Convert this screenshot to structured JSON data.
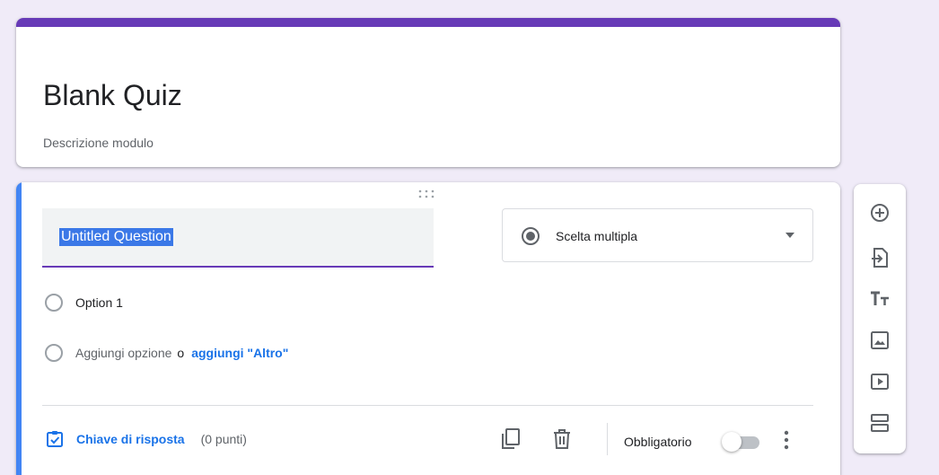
{
  "form": {
    "title": "Blank Quiz",
    "description": "Descrizione modulo"
  },
  "question": {
    "title": "Untitled Question",
    "type_label": "Scelta multipla",
    "options": [
      {
        "label": "Option 1"
      }
    ],
    "add_option_label": "Aggiungi opzione",
    "or_label": "o",
    "add_other_label": "aggiungi \"Altro\"",
    "answer_key_label": "Chiave di risposta",
    "points_label": "(0 punti)",
    "required_label": "Obbligatorio",
    "required_on": false
  },
  "toolbar": {
    "items": [
      {
        "icon": "add-question-icon"
      },
      {
        "icon": "import-questions-icon"
      },
      {
        "icon": "add-title-icon"
      },
      {
        "icon": "add-image-icon"
      },
      {
        "icon": "add-video-icon"
      },
      {
        "icon": "add-section-icon"
      }
    ]
  },
  "colors": {
    "background": "#f0ebf8",
    "theme": "#673ab7",
    "focus_accent": "#4285f4",
    "link": "#1a73e8"
  }
}
